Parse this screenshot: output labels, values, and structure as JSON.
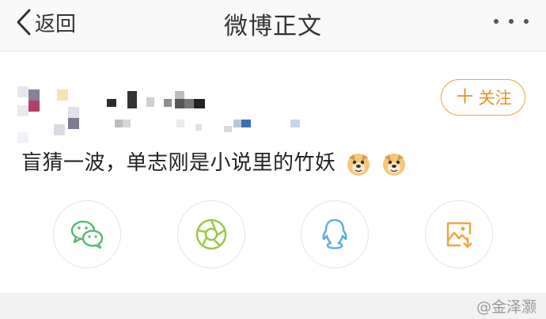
{
  "nav": {
    "back_label": "返回",
    "title": "微博正文"
  },
  "post": {
    "follow_label": "关注",
    "text": "盲猜一波，单志刚是小说里的竹妖"
  },
  "share": {
    "items": [
      "wechat-icon",
      "moments-icon",
      "qq-icon",
      "save-image-icon"
    ]
  },
  "watermark": {
    "text": "@金泽灏"
  },
  "colors": {
    "accent": "#f1a340",
    "wechat": "#5cb878",
    "moments": "#9bc848",
    "qq": "#5aafe0",
    "save": "#f0a63e"
  }
}
